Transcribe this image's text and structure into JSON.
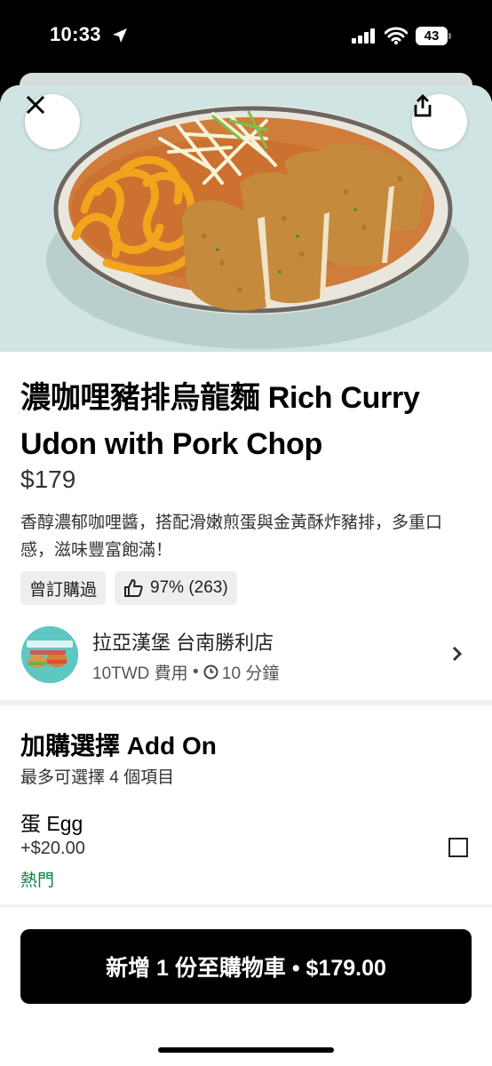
{
  "status_bar": {
    "time": "10:33",
    "battery": "43"
  },
  "item": {
    "title": "濃咖哩豬排烏龍麵 Rich Curry Udon with Pork Chop",
    "price": "$179",
    "description": "香醇濃郁咖哩醬，搭配滑嫩煎蛋與金黃酥炸豬排，多重口感，滋味豐富飽滿！",
    "tags": {
      "ordered_before": "曾訂購過",
      "rating": "97% (263)"
    }
  },
  "store": {
    "name": "拉亞漢堡 台南勝利店",
    "fee": "10TWD 費用",
    "separator": " • ",
    "time": "10 分鐘"
  },
  "addon": {
    "title": "加購選擇 Add On",
    "subtitle": "最多可選擇 4 個項目",
    "options": [
      {
        "name": "蛋 Egg",
        "price": "+$20.00",
        "badge": "熱門"
      }
    ]
  },
  "cta": {
    "label": "新增 1 份至購物車 • $179.00"
  },
  "icons": {
    "close": "close-icon",
    "share": "share-icon",
    "thumbs_up": "thumbs-up-icon",
    "clock": "clock-icon",
    "chevron": "chevron-right-icon"
  },
  "colors": {
    "popular": "#0e8345",
    "hero_bg": "#cfe4e3",
    "cta_bg": "#000000"
  }
}
